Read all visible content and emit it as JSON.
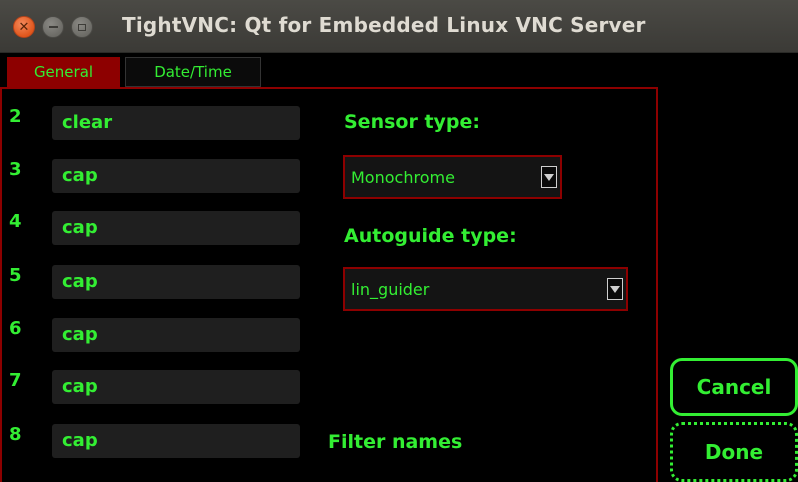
{
  "window": {
    "title": "TightVNC: Qt for Embedded Linux VNC Server"
  },
  "tabs": [
    {
      "label": "General",
      "active": true
    },
    {
      "label": "Date/Time",
      "active": false
    }
  ],
  "rows": [
    {
      "number": "2",
      "value": "clear"
    },
    {
      "number": "3",
      "value": "cap"
    },
    {
      "number": "4",
      "value": "cap"
    },
    {
      "number": "5",
      "value": "cap"
    },
    {
      "number": "6",
      "value": "cap"
    },
    {
      "number": "7",
      "value": "cap"
    },
    {
      "number": "8",
      "value": "cap"
    }
  ],
  "sensor": {
    "label": "Sensor type:",
    "selected": "Monochrome"
  },
  "autoguide": {
    "label": "Autoguide type:",
    "selected": "lin_guider"
  },
  "filter_names_label": "Filter names",
  "buttons": {
    "cancel": "Cancel",
    "done": "Done"
  },
  "colors": {
    "accent_green": "#33ee33",
    "dark_red": "#8d0000",
    "close_button": "#e0561c"
  },
  "icons": {
    "close": "close-icon",
    "minimize": "minimize-icon",
    "maximize": "maximize-icon",
    "dropdown": "chevron-down-icon"
  }
}
